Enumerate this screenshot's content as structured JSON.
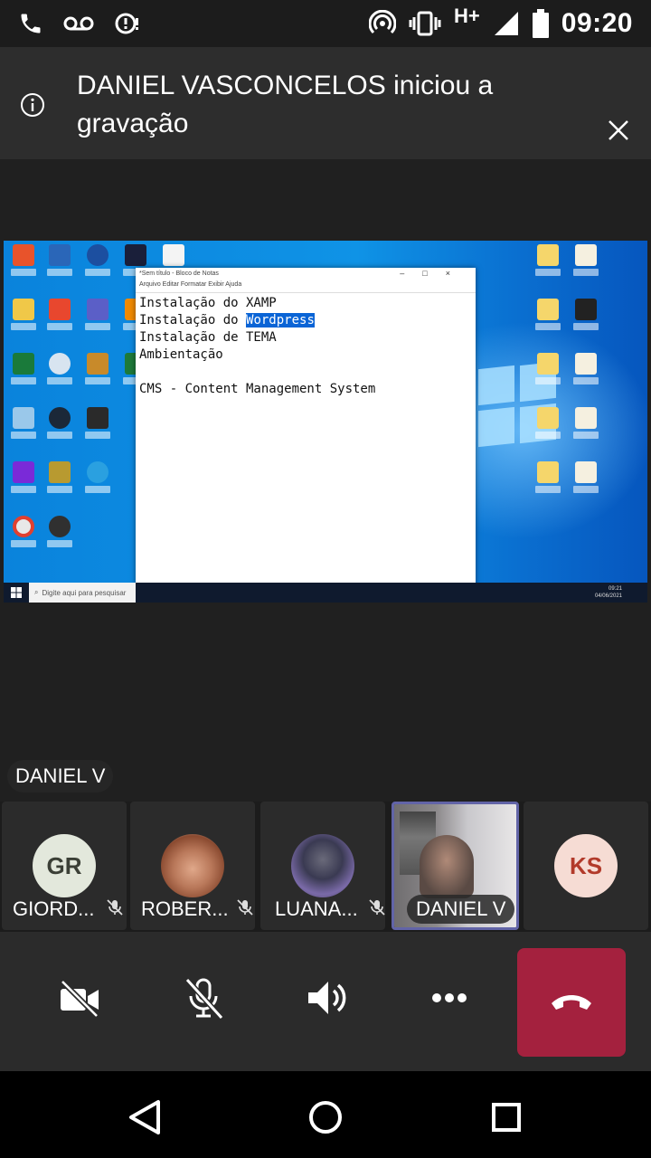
{
  "status_bar": {
    "time": "09:20",
    "network": "H+",
    "icons": [
      "phone-icon",
      "voicemail-icon",
      "sync-alert-icon",
      "hotspot-icon",
      "vibrate-icon",
      "signal-icon",
      "battery-icon"
    ]
  },
  "banner": {
    "message": "DANIEL VASCONCELOS iniciou a gravação",
    "info_icon": "info-icon",
    "close_icon": "close-icon"
  },
  "shared_screen": {
    "notepad": {
      "title": "*Sem título - Bloco de Notas",
      "menu": "Arquivo  Editar  Formatar  Exibir  Ajuda",
      "line1": "Instalação do XAMP",
      "line2_prefix": "Instalação do ",
      "line2_highlight": "Wordpress",
      "line3": "Instalação de TEMA",
      "line4": "Ambientação",
      "line5": "CMS - Content Management System"
    },
    "taskbar": {
      "search_placeholder": "Digite aqui para pesquisar",
      "clock_time": "09:21",
      "clock_date": "04/06/2021"
    }
  },
  "active_speaker": "DANIEL V",
  "participants": [
    {
      "initials": "GR",
      "name": "GIORD...",
      "muted": true,
      "avatar_bg": "#e3e8dc",
      "avatar_fg": "#3b3f36"
    },
    {
      "initials": "",
      "name": "ROBER...",
      "muted": true,
      "photo": true
    },
    {
      "initials": "",
      "name": "LUANA...",
      "muted": true,
      "photo": true
    },
    {
      "initials": "",
      "name": "DANIEL V",
      "muted": false,
      "video": true
    },
    {
      "initials": "KS",
      "name": "",
      "muted": false,
      "avatar_bg": "#f6dcd4",
      "avatar_fg": "#b23a2a"
    }
  ],
  "controls": {
    "icons": [
      "camera-off-icon",
      "mic-off-icon",
      "speaker-icon",
      "more-icon",
      "hang-up-icon"
    ],
    "hangup_color": "#a4213e"
  },
  "nav": {
    "icons": [
      "back-icon",
      "home-icon",
      "recents-icon"
    ]
  }
}
